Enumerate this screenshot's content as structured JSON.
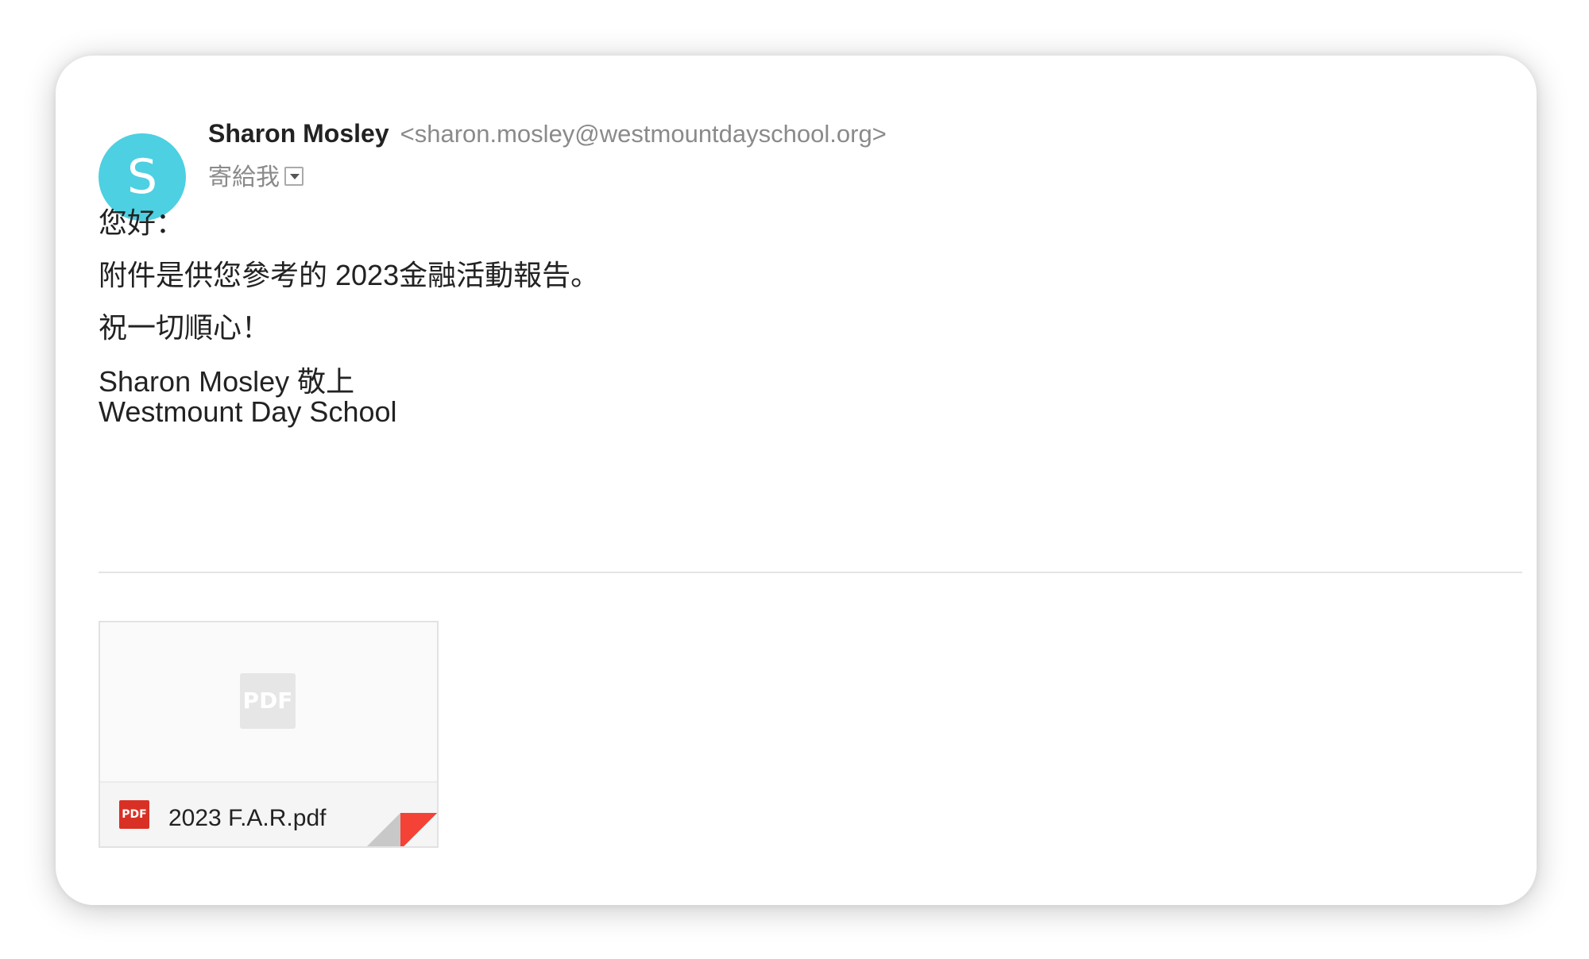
{
  "sender": {
    "avatar_letter": "S",
    "avatar_color": "#4dd0e1",
    "name": "Sharon Mosley",
    "email": "<sharon.mosley@westmountdayschool.org>",
    "to_label": "寄給我"
  },
  "body": {
    "greeting": "您好：",
    "line1": "附件是供您參考的 2023金融活動報告。",
    "closing": "祝一切順心！",
    "signature_name": "Sharon Mosley 敬上",
    "signature_org": "Westmount Day School"
  },
  "attachment": {
    "preview_icon_label": "PDF",
    "type_icon_label": "PDF",
    "filename": "2023 F.A.R.pdf",
    "accent_color": "#f44336"
  }
}
